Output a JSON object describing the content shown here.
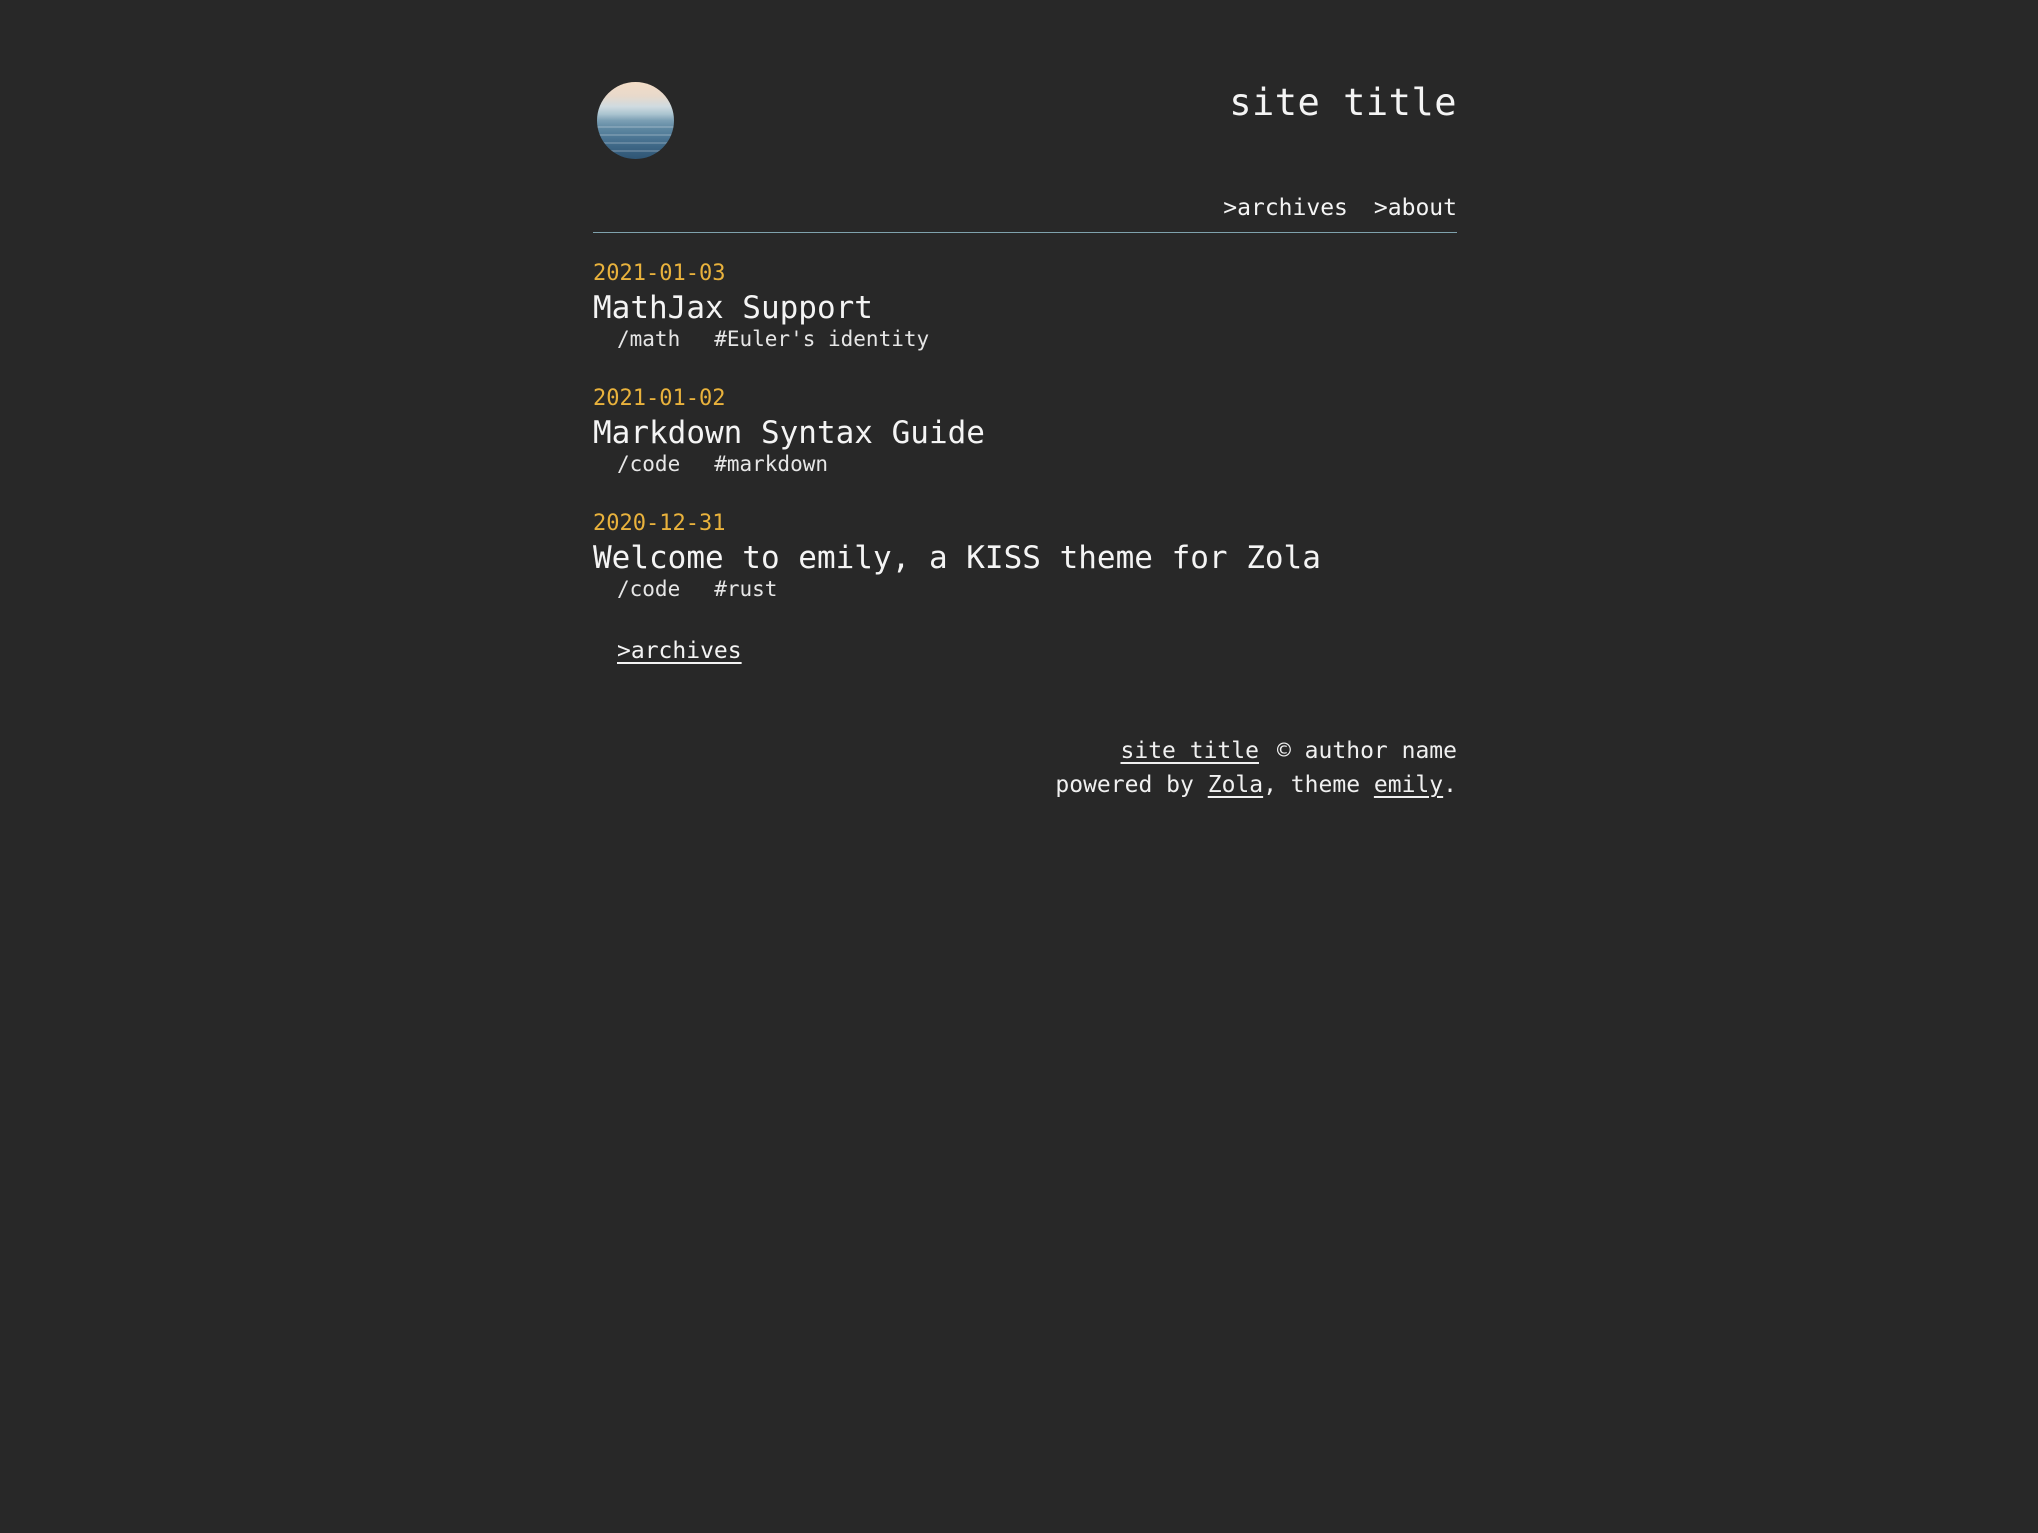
{
  "header": {
    "site_title": "site title",
    "avatar_icon": "ocean-avatar-image",
    "nav": [
      {
        "label": ">archives"
      },
      {
        "label": ">about"
      }
    ]
  },
  "posts": [
    {
      "date": "2021-01-03",
      "title": "MathJax Support",
      "category": "/math",
      "tag": "#Euler's identity"
    },
    {
      "date": "2021-01-02",
      "title": "Markdown Syntax Guide",
      "category": "/code",
      "tag": "#markdown"
    },
    {
      "date": "2020-12-31",
      "title": "Welcome to emily, a KISS theme for Zola",
      "category": "/code",
      "tag": "#rust"
    }
  ],
  "more_link": ">archives",
  "footer": {
    "site_title": "site title",
    "copyright": "© author name",
    "powered_by": "powered by ",
    "zola": "Zola",
    "theme_text": ", theme ",
    "emily": "emily",
    "period": "."
  },
  "colors": {
    "background": "#282828",
    "date_accent": "#e9b23c",
    "divider": "#7fa2ad",
    "text": "#f4f4f4"
  }
}
